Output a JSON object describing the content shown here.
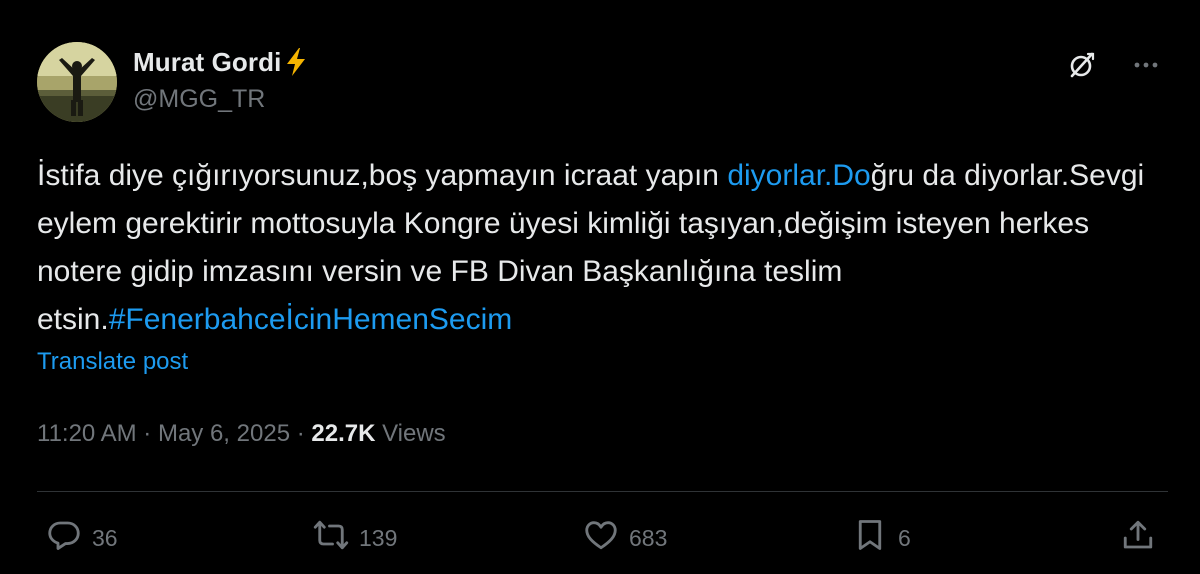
{
  "author": {
    "display_name": "Murat Gordi",
    "handle": "@MGG_TR",
    "badge_icon": "lightning-bolt-icon",
    "badge_color": "#f5b400"
  },
  "header_actions": {
    "grok_icon": "grok-icon",
    "more_icon": "more-icon"
  },
  "post": {
    "segments": [
      {
        "text": "İstifa diye çığırıyorsunuz,boş yapmayın icraat yapın ",
        "type": "text"
      },
      {
        "text": "diyorlar.Do",
        "type": "link"
      },
      {
        "text": "ğru da diyorlar.Sevgi eylem gerektirir mottosuyla Kongre üyesi kimliği taşıyan,değişim isteyen herkes notere gidip imzasını versin ve FB Divan Başkanlığına teslim etsin.",
        "type": "text"
      },
      {
        "text": "#FenerbahceİcinHemenSecim",
        "type": "link"
      }
    ],
    "translate_label": "Translate post"
  },
  "meta": {
    "time": "11:20 AM",
    "separator": " · ",
    "date": "May 6, 2025",
    "views_count": "22.7K",
    "views_label": " Views"
  },
  "actions": {
    "replies": "36",
    "reposts": "139",
    "likes": "683",
    "bookmarks": "6"
  },
  "colors": {
    "background": "#000000",
    "text": "#e7e9ea",
    "secondary": "#71767b",
    "link": "#1d9bf0",
    "divider": "#2f3336"
  }
}
